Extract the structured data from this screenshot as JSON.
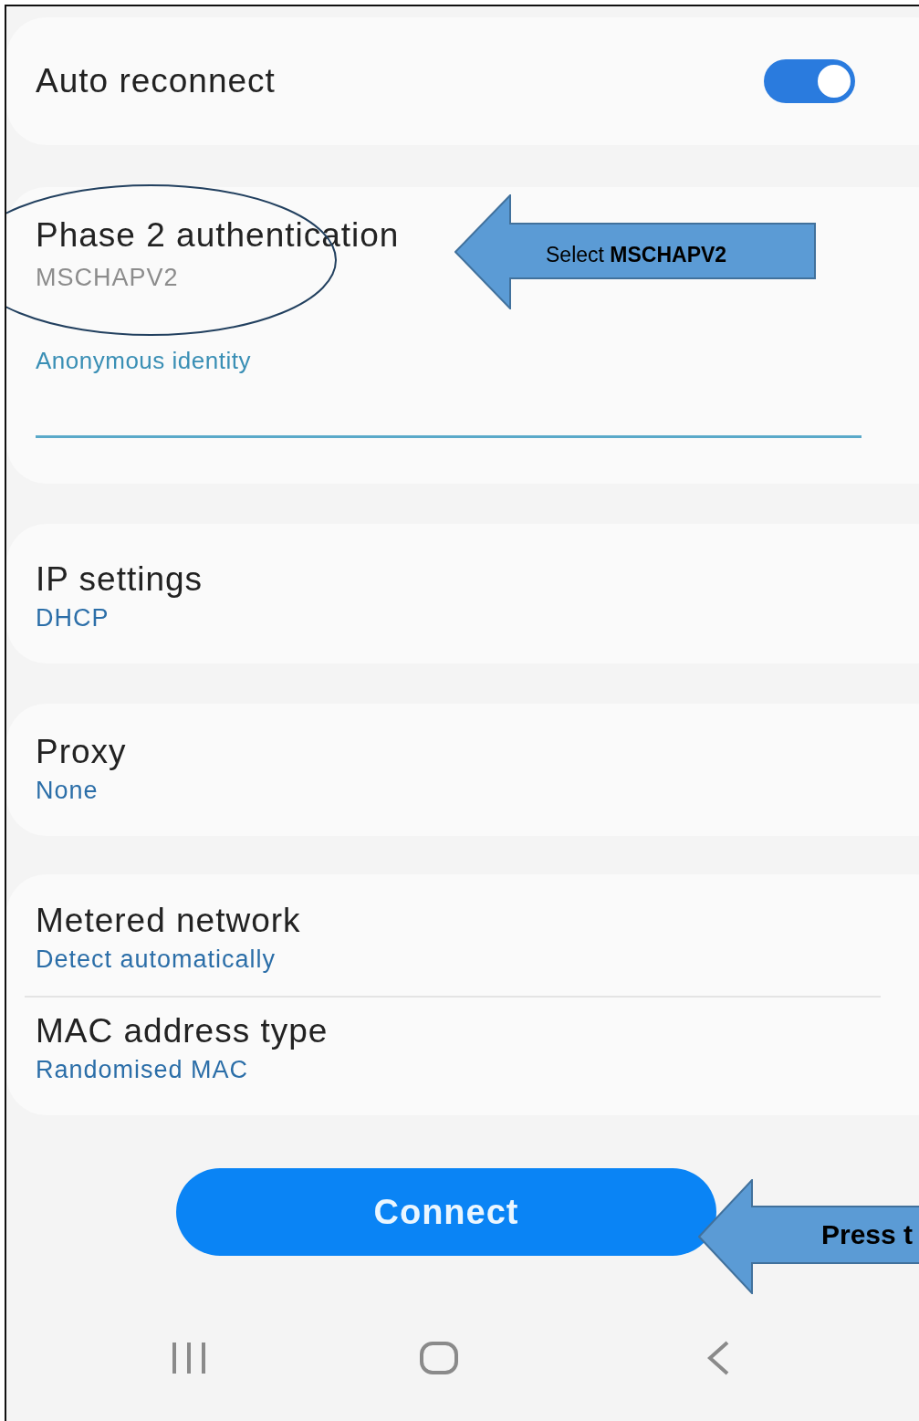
{
  "auto_reconnect": {
    "label": "Auto reconnect",
    "on": true
  },
  "eap_card": {
    "phase2": {
      "label": "Phase 2 authentication",
      "value": "MSCHAPV2"
    },
    "anonymous_identity": {
      "label": "Anonymous identity"
    }
  },
  "settings_cards": [
    {
      "items": [
        {
          "label": "IP settings",
          "value": "DHCP"
        }
      ]
    },
    {
      "items": [
        {
          "label": "Proxy",
          "value": "None"
        }
      ]
    },
    {
      "items": [
        {
          "label": "Metered network",
          "value": "Detect automatically"
        },
        {
          "label": "MAC address type",
          "value": "Randomised MAC"
        }
      ]
    }
  ],
  "connect_button": "Connect",
  "callouts": [
    {
      "kind": "arrow-mid",
      "text": "Select **MSCHAPV2**"
    },
    {
      "kind": "arrow-bottom",
      "text": "Press t"
    }
  ]
}
